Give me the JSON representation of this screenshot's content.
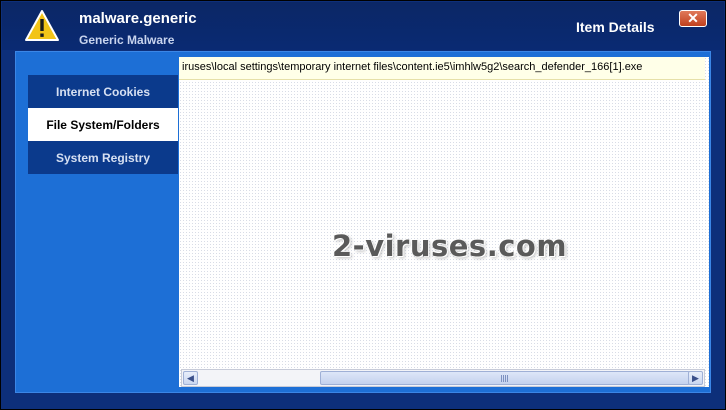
{
  "header": {
    "threat_name": "malware.generic",
    "threat_type": "Generic Malware",
    "panel_title": "Item Details",
    "close_symbol": "✕",
    "icon": "warning-triangle-icon"
  },
  "sidebar": {
    "items": [
      {
        "label": "Internet Cookies",
        "active": false
      },
      {
        "label": "File System/Folders",
        "active": true
      },
      {
        "label": "System Registry",
        "active": false
      }
    ]
  },
  "content": {
    "path_entry": "iruses\\local settings\\temporary internet files\\content.ie5\\imhlw5g2\\search_defender_166[1].exe",
    "watermark": "2-viruses.com"
  },
  "scrollbar": {
    "left_arrow": "◀",
    "right_arrow": "▶"
  },
  "colors": {
    "accent_blue": "#1d6fd6",
    "sidebar_dark": "#0b3a8c",
    "title_bar": "#0b2766",
    "close_red": "#c0401e"
  }
}
